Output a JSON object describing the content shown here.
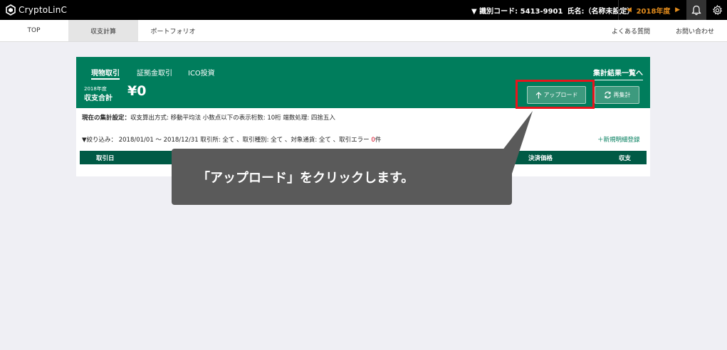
{
  "topbar": {
    "logo_text": "CryptoLinC",
    "id_label": "▼ 識別コード: 5413-9901",
    "name_label": "氏名:（名称未設定）",
    "year": "2018年度",
    "prev_arrow": "◀",
    "next_arrow": "▶",
    "bell_icon": "bell-icon",
    "gear_icon": "gear-icon",
    "accent_color": "#e38c1d"
  },
  "nav": {
    "top": "TOP",
    "calc": "収支計算",
    "portfolio": "ポートフォリオ",
    "faq": "よくある質問",
    "contact": "お問い合わせ"
  },
  "card": {
    "tabs": [
      "現物取引",
      "証拠金取引",
      "ICO投資"
    ],
    "results_link": "集計結果一覧へ",
    "year_small": "2018年度",
    "total_label": "収支合計",
    "total_value": "¥0",
    "upload_button": "アップロード",
    "recalc_button": "再集計",
    "brand_color": "#007d5c",
    "setting_prefix": "現在の集計設定：",
    "setting_text": "収支算出方式: 移動平均法  小数点以下の表示桁数: 10桁  端数処理: 四捨五入",
    "filter_text": "▼絞り込み： 2018/01/01 〜 2018/12/31  取引所: 全て 、取引種別: 全て 、対象通貨: 全て 、取引エラー",
    "error_count": "0",
    "error_suffix": "件",
    "new_register": "＋新規明細登録",
    "table_headers": {
      "date": "取引日",
      "price": "決済価格",
      "pl": "収支"
    }
  },
  "tooltip": {
    "text": "「アップロード」をクリックします。"
  },
  "highlight_color": "#e8141c"
}
